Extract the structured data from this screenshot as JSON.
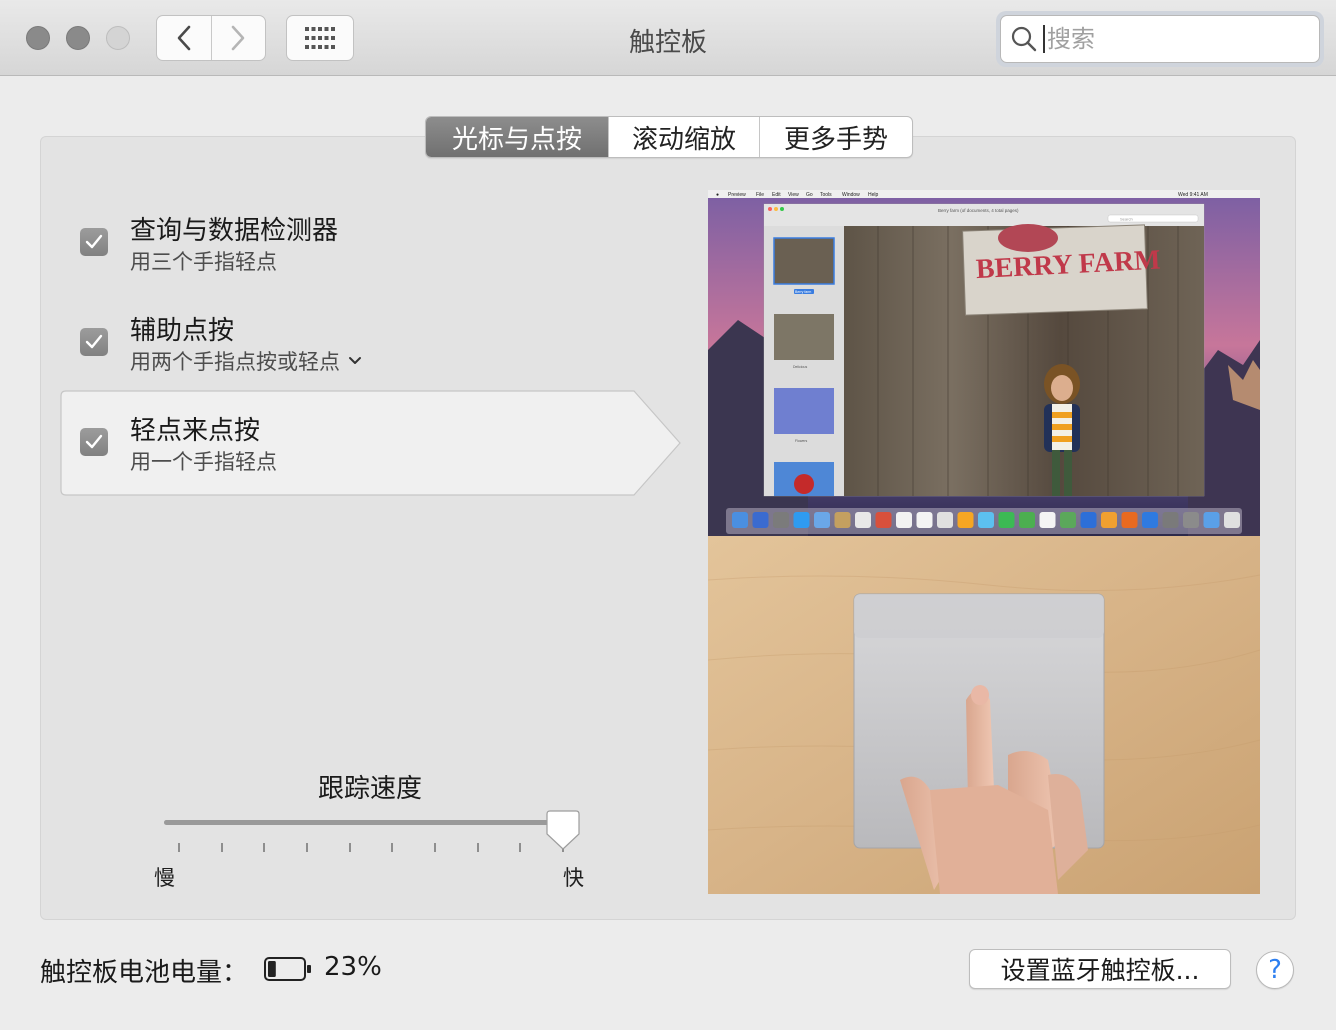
{
  "window": {
    "title": "触控板",
    "search_placeholder": "搜索"
  },
  "tabs": [
    {
      "label": "光标与点按",
      "active": true
    },
    {
      "label": "滚动缩放",
      "active": false
    },
    {
      "label": "更多手势",
      "active": false
    }
  ],
  "options": [
    {
      "title": "查询与数据检测器",
      "subtitle": "用三个手指轻点",
      "checked": true,
      "has_dropdown": false
    },
    {
      "title": "辅助点按",
      "subtitle": "用两个手指点按或轻点",
      "checked": true,
      "has_dropdown": true
    },
    {
      "title": "轻点来点按",
      "subtitle": "用一个手指轻点",
      "checked": true,
      "has_dropdown": false,
      "selected": true
    }
  ],
  "tracking": {
    "label": "跟踪速度",
    "min_label": "慢",
    "max_label": "快",
    "value_fraction": 1.0,
    "tick_count": 10
  },
  "preview": {
    "menubar": [
      "Preview",
      "File",
      "Edit",
      "View",
      "Go",
      "Tools",
      "Window",
      "Help"
    ],
    "clock": "Wed 9:41 AM",
    "doc_title": "Berry farm (of documents, 4 total pages)",
    "search": "Search",
    "sign_text": "BERRY FARM",
    "thumbnails": [
      "Berry farm",
      "Delicious",
      "Flowers"
    ]
  },
  "footer": {
    "battery_label": "触控板电池电量：",
    "battery_percent": "23%",
    "battery_level": 0.23,
    "setup_button": "设置蓝牙触控板...",
    "help": "?"
  },
  "colors": {
    "accent_blue": "#2d7ff0",
    "tab_active": "#7d7d7d",
    "checkbox": "#8c8c8c"
  }
}
